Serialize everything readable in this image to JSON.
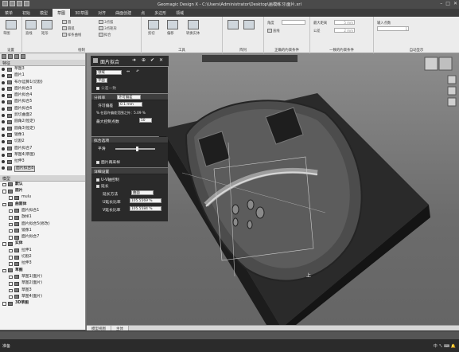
{
  "app": {
    "title": "Geomagic Design X - C:\\Users\\Administrator\\Desktop\\画模练习\\面片.xrl"
  },
  "menu": {
    "items": [
      "菜单",
      "初始",
      "模型",
      "草图",
      "3D草图",
      "对齐",
      "曲面创建",
      "点",
      "多边形",
      "领域"
    ],
    "active_index": 3
  },
  "ribbon": {
    "groups": [
      {
        "label": "设置"
      },
      {
        "label": "绘制"
      },
      {
        "label": "工具"
      },
      {
        "label": "阵列"
      },
      {
        "label": "正确的约束条件"
      },
      {
        "label": "一致的约束条件"
      },
      {
        "label": "自动显示"
      }
    ],
    "sketch_btn": "草图",
    "exit_btn": "退出",
    "draw_items": [
      "直线",
      "矩形",
      "圆",
      "圆弧",
      "样条曲线",
      "3点弧",
      "3点矩形",
      "拟合"
    ],
    "tool_items": [
      "剪切",
      "偏移",
      "转换实体"
    ],
    "constraint_items": [
      "角度",
      "直线",
      "自由"
    ],
    "dist_label": "最大距离",
    "dist_value": "5 mm",
    "tol_label": "公差",
    "tol_value": "2 mm",
    "right_label": "输入点数",
    "right_value": "1"
  },
  "left_panel": {
    "header": "特征",
    "features": [
      {
        "name": "草图3",
        "type": "sketch"
      },
      {
        "name": "面片1",
        "type": "mesh"
      },
      {
        "name": "布尔运算1(切割)",
        "type": "cut"
      },
      {
        "name": "面片拟合3",
        "type": "fit"
      },
      {
        "name": "面片拟合4",
        "type": "fit"
      },
      {
        "name": "面片拟合5",
        "type": "fit"
      },
      {
        "name": "面片拟合6",
        "type": "fit"
      },
      {
        "name": "剪切曲面2",
        "type": "trim"
      },
      {
        "name": "圆角2(恒定)",
        "type": "fillet"
      },
      {
        "name": "圆角3(恒定)",
        "type": "fillet"
      },
      {
        "name": "镜像1",
        "type": "mirror"
      },
      {
        "name": "切割2",
        "type": "cut"
      },
      {
        "name": "面片拟合7",
        "type": "fit"
      },
      {
        "name": "草图4(草图)",
        "type": "sketch"
      },
      {
        "name": "拉伸3",
        "type": "extrude"
      },
      {
        "name": "面片拟合8",
        "type": "fit",
        "selected": true
      }
    ],
    "model_header": "模型",
    "model": [
      {
        "name": "默认",
        "level": 0,
        "bold": true
      },
      {
        "name": "面片",
        "level": 0,
        "bold": true
      },
      {
        "name": "mulu",
        "level": 1
      },
      {
        "name": "曲面体",
        "level": 0,
        "bold": true
      },
      {
        "name": "面片拟合1",
        "level": 1
      },
      {
        "name": "放样1",
        "level": 1
      },
      {
        "name": "面片拟合5(修改)",
        "level": 1
      },
      {
        "name": "镜像1",
        "level": 1
      },
      {
        "name": "面片拟合7",
        "level": 1
      },
      {
        "name": "实体",
        "level": 0,
        "bold": true
      },
      {
        "name": "拉伸1",
        "level": 1
      },
      {
        "name": "切割2",
        "level": 1
      },
      {
        "name": "拉伸3",
        "level": 1
      },
      {
        "name": "草图",
        "level": 0,
        "bold": true
      },
      {
        "name": "草图1(面片)",
        "level": 1
      },
      {
        "name": "草图2(面片)",
        "level": 1
      },
      {
        "name": "草图3",
        "level": 1
      },
      {
        "name": "草图4(面片)",
        "level": 1
      },
      {
        "name": "3D草图",
        "level": 0,
        "bold": true
      }
    ]
  },
  "dialog": {
    "title": "面片拟合",
    "sec_area": {
      "field": "领域",
      "sub1": "平面",
      "sub2": "公差一致"
    },
    "sec_res": {
      "header": "分辨率",
      "mode": "许可偏差",
      "tol_label": "许可偏差",
      "tol_value": "0.1 mm",
      "deviation": "% 在容许偏差范围之外：5.09 %",
      "max_label": "最大控制点数",
      "max_value": "50"
    },
    "sec_smooth": {
      "header": "拟合选项",
      "smooth_label": "平滑",
      "check_label": "面片再采样"
    },
    "sec_detail": {
      "header": "详细设置",
      "chk1": "U-V轴控制",
      "chk2": "延长",
      "method_label": "延长方法",
      "method_value": "曲面",
      "u_label": "U延长比率",
      "u_value": "105.5569 %",
      "v_label": "V延长比率",
      "v_value": "105.5584 %"
    }
  },
  "viewport": {
    "tabs": [
      "模型视图",
      "主体"
    ],
    "axis_label": "上"
  },
  "status": {
    "left": "准备",
    "tray": "中 ㄟ ⌨ 🔔"
  }
}
